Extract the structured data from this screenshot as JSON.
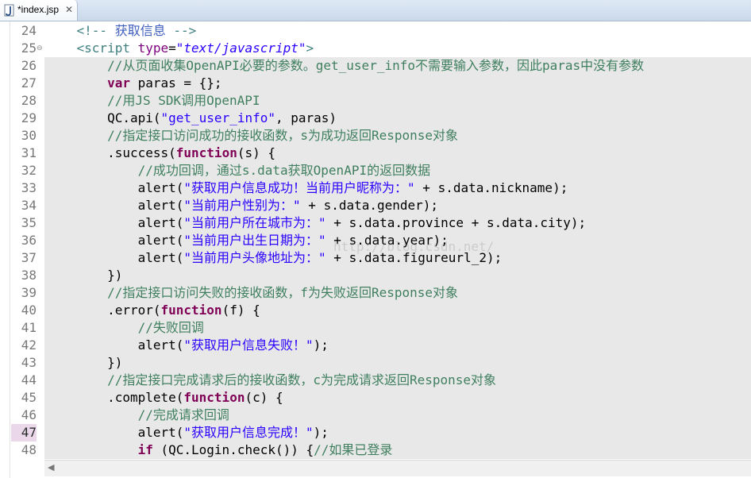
{
  "tab": {
    "title": "*index.jsp",
    "close": "✕",
    "icon": "jsp-file-icon"
  },
  "colors": {
    "keyword": "#7f0055",
    "comment": "#3f7f5f",
    "string": "#2a00ff",
    "tag": "#3f7f7f",
    "attribute": "#7f007f",
    "highlight": "#e8e8e8"
  },
  "watermark": "http://blog.csdn.net/",
  "scrollbar": {
    "left_arrow": "◀"
  },
  "current_line": 47,
  "lines": [
    {
      "no": "24",
      "fold": "",
      "segments": [
        [
          "tag",
          "    <!-- "
        ],
        [
          "hcm",
          "获取信息"
        ],
        [
          "tag",
          " -->"
        ]
      ]
    },
    {
      "no": "25",
      "fold": "⊖",
      "segments": [
        [
          "tag",
          "    <script "
        ],
        [
          "att",
          "type"
        ],
        [
          "plain",
          "="
        ],
        [
          "attv",
          "\"text/javascript\""
        ],
        [
          "tag",
          ">"
        ]
      ]
    },
    {
      "no": "26",
      "fold": "",
      "segments": [
        [
          "cm",
          "        //从页面收集OpenAPI必要的参数。get_user_info不需要输入参数，因此paras中没有参数"
        ]
      ]
    },
    {
      "no": "27",
      "fold": "",
      "segments": [
        [
          "plain",
          "        "
        ],
        [
          "kw",
          "var"
        ],
        [
          "plain",
          " paras = {};"
        ]
      ]
    },
    {
      "no": "28",
      "fold": "",
      "segments": [
        [
          "cm",
          "        //用JS SDK调用OpenAPI"
        ]
      ]
    },
    {
      "no": "29",
      "fold": "",
      "segments": [
        [
          "plain",
          "        QC.api("
        ],
        [
          "str",
          "\"get_user_info\""
        ],
        [
          "plain",
          ", paras)"
        ]
      ]
    },
    {
      "no": "30",
      "fold": "",
      "segments": [
        [
          "cm",
          "        //指定接口访问成功的接收函数，s为成功返回Response对象"
        ]
      ]
    },
    {
      "no": "31",
      "fold": "",
      "segments": [
        [
          "plain",
          "        .success("
        ],
        [
          "kw",
          "function"
        ],
        [
          "plain",
          "(s) {"
        ]
      ]
    },
    {
      "no": "32",
      "fold": "",
      "segments": [
        [
          "cm",
          "            //成功回调，通过s.data获取OpenAPI的返回数据"
        ]
      ]
    },
    {
      "no": "33",
      "fold": "",
      "segments": [
        [
          "plain",
          "            alert("
        ],
        [
          "str",
          "\"获取用户信息成功！当前用户昵称为：\""
        ],
        [
          "plain",
          " + s.data.nickname);"
        ]
      ]
    },
    {
      "no": "34",
      "fold": "",
      "segments": [
        [
          "plain",
          "            alert("
        ],
        [
          "str",
          "\"当前用户性别为：\""
        ],
        [
          "plain",
          " + s.data.gender);"
        ]
      ]
    },
    {
      "no": "35",
      "fold": "",
      "segments": [
        [
          "plain",
          "            alert("
        ],
        [
          "str",
          "\"当前用户所在城市为：\""
        ],
        [
          "plain",
          " + s.data.province + s.data.city);"
        ]
      ]
    },
    {
      "no": "36",
      "fold": "",
      "segments": [
        [
          "plain",
          "            alert("
        ],
        [
          "str",
          "\"当前用户出生日期为：\""
        ],
        [
          "plain",
          " + s.data.year);"
        ]
      ]
    },
    {
      "no": "37",
      "fold": "",
      "segments": [
        [
          "plain",
          "            alert("
        ],
        [
          "str",
          "\"当前用户头像地址为：\""
        ],
        [
          "plain",
          " + s.data.figureurl_2);"
        ]
      ]
    },
    {
      "no": "38",
      "fold": "",
      "segments": [
        [
          "plain",
          "        })"
        ]
      ]
    },
    {
      "no": "39",
      "fold": "",
      "segments": [
        [
          "cm",
          "        //指定接口访问失败的接收函数，f为失败返回Response对象"
        ]
      ]
    },
    {
      "no": "40",
      "fold": "",
      "segments": [
        [
          "plain",
          "        .error("
        ],
        [
          "kw",
          "function"
        ],
        [
          "plain",
          "(f) {"
        ]
      ]
    },
    {
      "no": "41",
      "fold": "",
      "segments": [
        [
          "cm",
          "            //失败回调"
        ]
      ]
    },
    {
      "no": "42",
      "fold": "",
      "segments": [
        [
          "plain",
          "            alert("
        ],
        [
          "str",
          "\"获取用户信息失败！\""
        ],
        [
          "plain",
          ");"
        ]
      ]
    },
    {
      "no": "43",
      "fold": "",
      "segments": [
        [
          "plain",
          "        })"
        ]
      ]
    },
    {
      "no": "44",
      "fold": "",
      "segments": [
        [
          "cm",
          "        //指定接口完成请求后的接收函数，c为完成请求返回Response对象"
        ]
      ]
    },
    {
      "no": "45",
      "fold": "",
      "segments": [
        [
          "plain",
          "        .complete("
        ],
        [
          "kw",
          "function"
        ],
        [
          "plain",
          "(c) {"
        ]
      ]
    },
    {
      "no": "46",
      "fold": "",
      "segments": [
        [
          "cm",
          "            //完成请求回调"
        ]
      ]
    },
    {
      "no": "47",
      "fold": "",
      "segments": [
        [
          "plain",
          "            alert("
        ],
        [
          "str",
          "\"获取用户信息完成！\""
        ],
        [
          "plain",
          ");"
        ]
      ]
    },
    {
      "no": "48",
      "fold": "",
      "segments": [
        [
          "plain",
          "            "
        ],
        [
          "kw",
          "if"
        ],
        [
          "plain",
          " (QC.Login.check()) {"
        ],
        [
          "cm",
          "//如果已登录"
        ]
      ]
    }
  ]
}
